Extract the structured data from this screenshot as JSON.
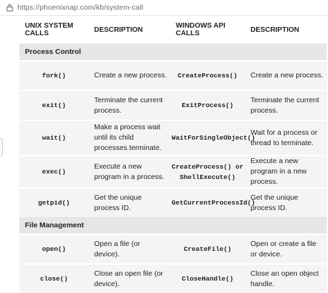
{
  "browser": {
    "url": "https://phoenixnap.com/kb/system-call"
  },
  "table": {
    "headers": [
      "UNIX SYSTEM CALLS",
      "DESCRIPTION",
      "WINDOWS API CALLS",
      "DESCRIPTION"
    ],
    "sections": [
      {
        "title": "Process Control",
        "rows": [
          {
            "unix": "fork()",
            "unix_desc": "Create a new process.",
            "win": "CreateProcess()",
            "win_desc": "Create a new process."
          },
          {
            "unix": "exit()",
            "unix_desc": "Terminate the current process.",
            "win": "ExitProcess()",
            "win_desc": "Terminate the current process."
          },
          {
            "unix": "wait()",
            "unix_desc": "Make a process wait until its child processes terminate.",
            "win": "WaitForSingleObject()",
            "win_desc": "Wait for a process or thread to terminate."
          },
          {
            "unix": "exec()",
            "unix_desc": "Execute a new program in a process.",
            "win": "CreateProcess() or ShellExecute()",
            "win_desc": "Execute a new program in a new process."
          },
          {
            "unix": "getpid()",
            "unix_desc": "Get the unique process ID.",
            "win": "GetCurrentProcessId()",
            "win_desc": "Get the unique process ID."
          }
        ]
      },
      {
        "title": "File Management",
        "rows": [
          {
            "unix": "open()",
            "unix_desc": "Open a file (or device).",
            "win": "CreateFile()",
            "win_desc": "Open or create a file or device."
          },
          {
            "unix": "close()",
            "unix_desc": "Close an open file (or device).",
            "win": "CloseHandle()",
            "win_desc": "Close an open object handle."
          }
        ]
      }
    ]
  }
}
